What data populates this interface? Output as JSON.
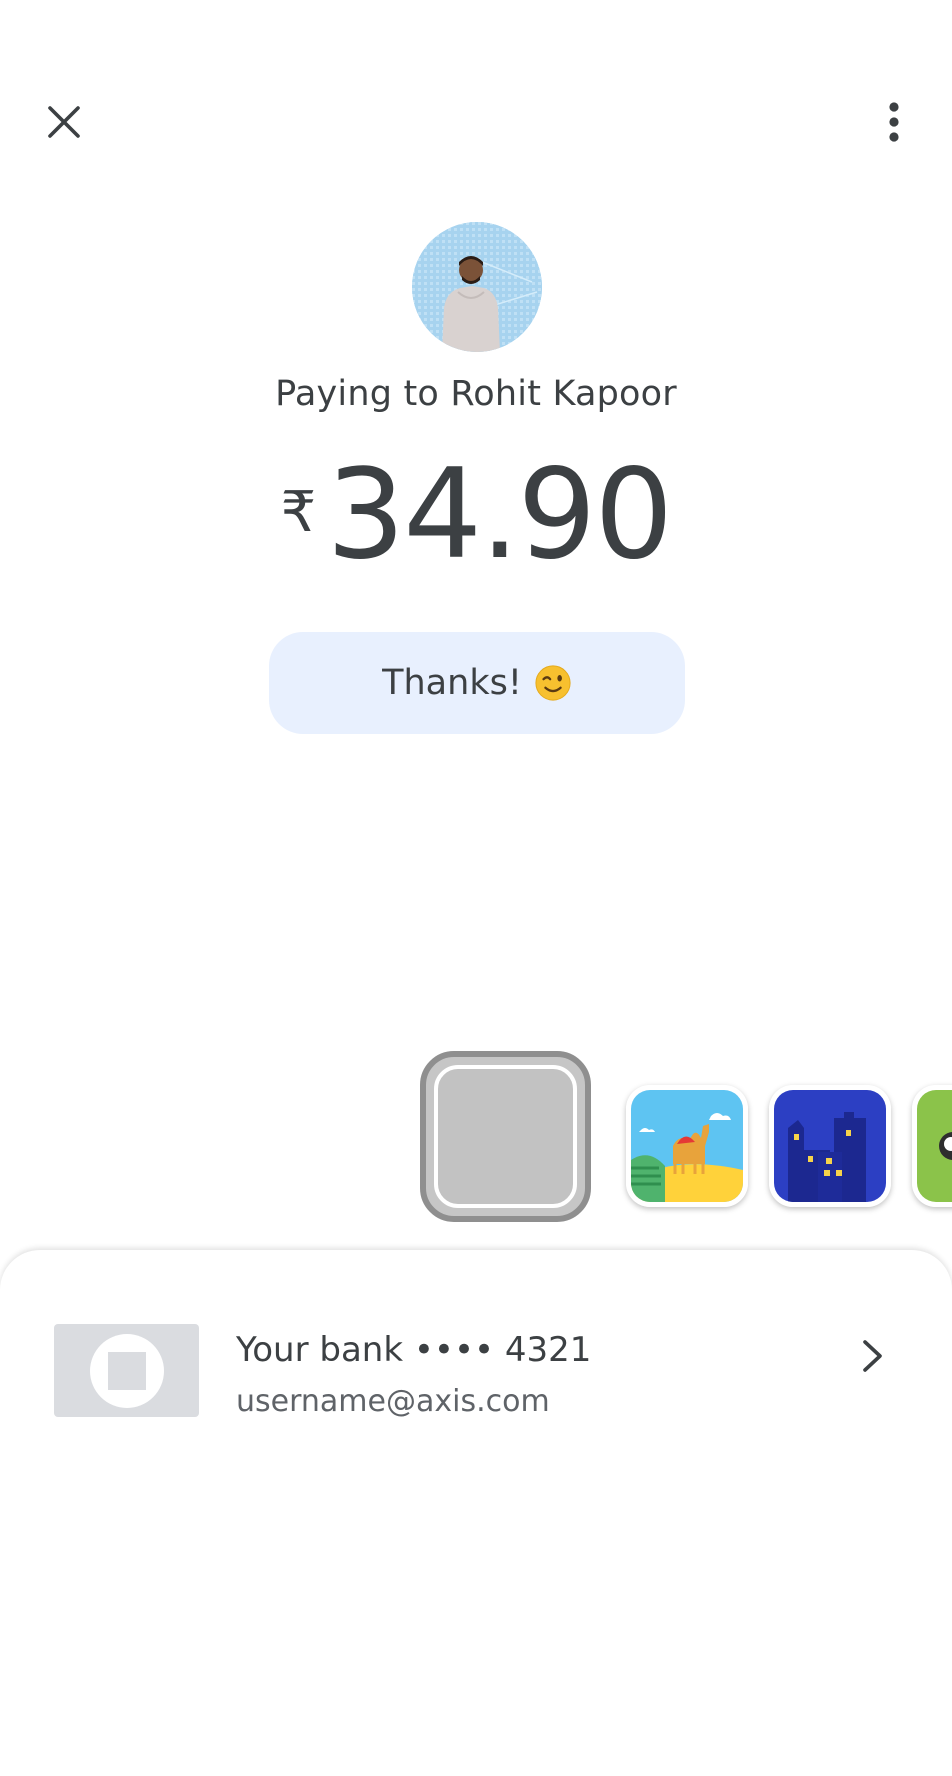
{
  "header": {
    "close_icon": "close-icon",
    "more_icon": "more-vert-icon"
  },
  "payee": {
    "avatar": "avatar",
    "label": "Paying to Rohit Kapoor"
  },
  "amount": {
    "currency": "₹",
    "value": "34.90"
  },
  "note": {
    "text": "Thanks!",
    "emoji": "winking-face-emoji"
  },
  "themes": {
    "items": [
      "selected-empty-theme",
      "desert-camel-theme",
      "city-night-theme",
      "green-theme"
    ]
  },
  "bank": {
    "name": "Your bank •••• 4321",
    "upi_id": "username@axis.com",
    "chevron_icon": "chevron-right-icon"
  },
  "colors": {
    "note_bg": "#e8f0fe",
    "text": "#3c4043",
    "muted": "#5f6368"
  }
}
